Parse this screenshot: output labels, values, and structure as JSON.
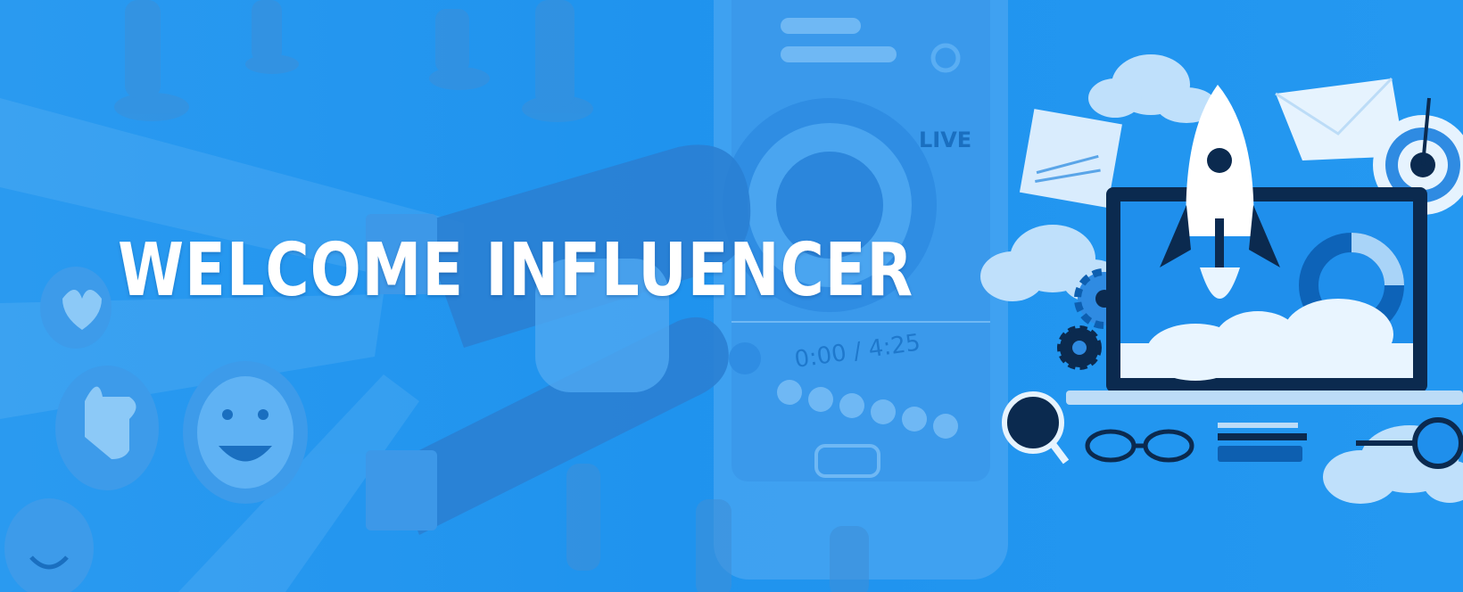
{
  "banner": {
    "headline": "WELCOME INFLUENCER",
    "phone_live_label": "LIVE",
    "phone_time": "0:00 / 4:25"
  },
  "colors": {
    "background": "#1f93ee",
    "headline": "#ffffff",
    "dark_navy": "#0b2a4f",
    "light_blue": "#bfe0fb"
  },
  "icons": [
    "heart-icon",
    "thumbs-up-icon",
    "smiley-icon",
    "magnet-icon",
    "smartphone-icon",
    "rocket-icon",
    "laptop-icon",
    "cloud-icon",
    "envelope-icon",
    "target-icon",
    "gear-icon",
    "magnifier-icon",
    "eyeglasses-icon",
    "pen-icon",
    "donut-chart-icon"
  ]
}
